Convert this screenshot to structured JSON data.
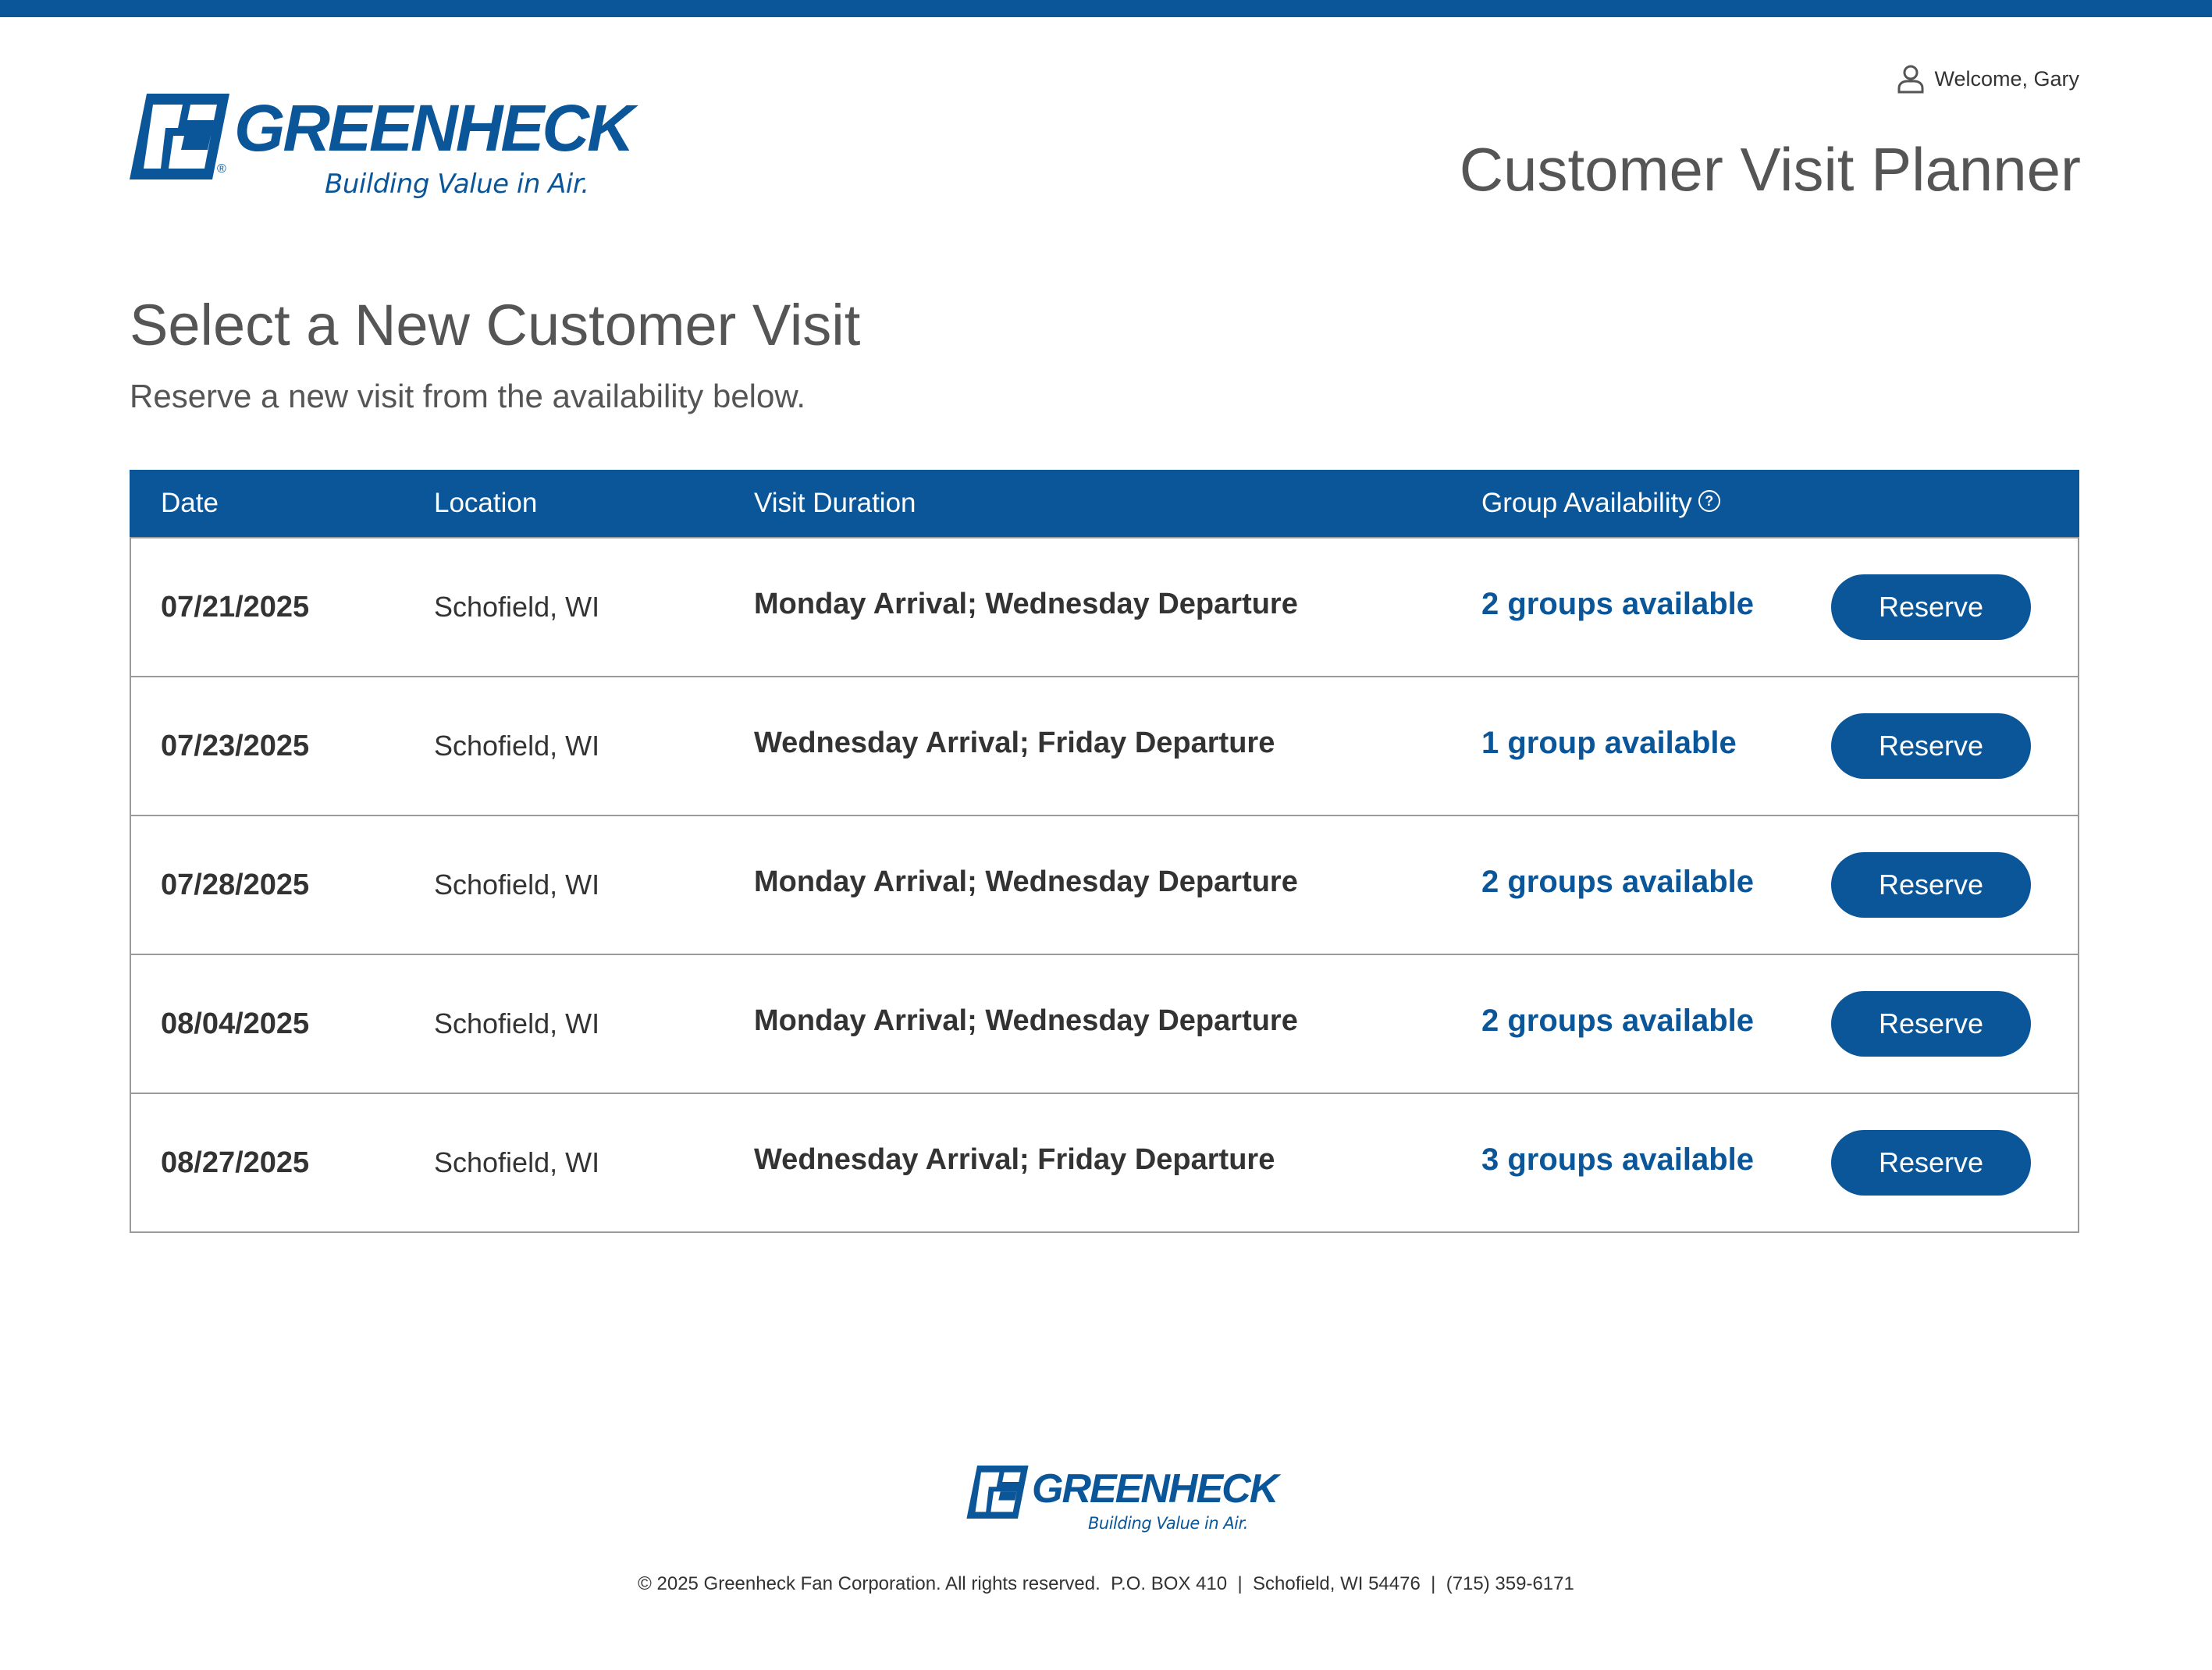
{
  "brand": {
    "name": "GREENHECK",
    "tagline": "Building Value in Air.",
    "registered": "®",
    "color": "#0a5699"
  },
  "header": {
    "welcome": "Welcome, Gary",
    "user_icon": "user-icon",
    "app_title": "Customer Visit Planner"
  },
  "page": {
    "title": "Select a New Customer Visit",
    "subtitle": "Reserve a new visit from the availability below."
  },
  "table": {
    "columns": {
      "date": "Date",
      "location": "Location",
      "duration": "Visit Duration",
      "availability": "Group Availability",
      "help_icon": "?"
    },
    "rows": [
      {
        "date": "07/21/2025",
        "location": "Schofield, WI",
        "duration": "Monday Arrival; Wednesday Departure",
        "availability": "2 groups available",
        "action": "Reserve"
      },
      {
        "date": "07/23/2025",
        "location": "Schofield, WI",
        "duration": "Wednesday Arrival; Friday Departure",
        "availability": "1 group available",
        "action": "Reserve"
      },
      {
        "date": "07/28/2025",
        "location": "Schofield, WI",
        "duration": "Monday Arrival; Wednesday Departure",
        "availability": "2 groups available",
        "action": "Reserve"
      },
      {
        "date": "08/04/2025",
        "location": "Schofield, WI",
        "duration": "Monday Arrival; Wednesday Departure",
        "availability": "2 groups available",
        "action": "Reserve"
      },
      {
        "date": "08/27/2025",
        "location": "Schofield, WI",
        "duration": "Wednesday Arrival; Friday Departure",
        "availability": "3 groups available",
        "action": "Reserve"
      }
    ]
  },
  "footer": {
    "copyright": "© 2025 Greenheck Fan Corporation. All rights reserved.  P.O. BOX 410  |  Schofield, WI 54476  |  (715) 359-6171"
  }
}
